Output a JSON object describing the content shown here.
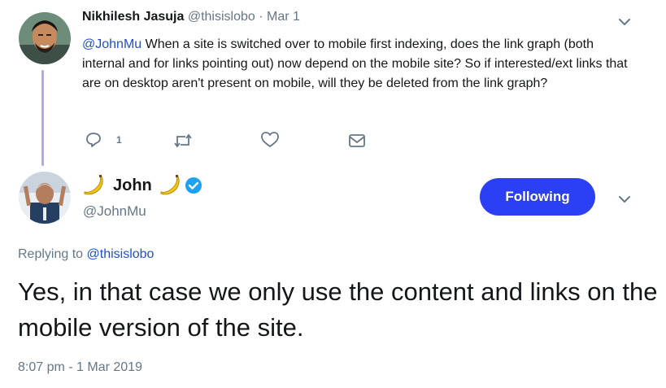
{
  "parent_tweet": {
    "author_name": "Nikhilesh Jasuja",
    "handle": "@thisislobo",
    "separator": "·",
    "date": "Mar 1",
    "mention": "@JohnMu",
    "body": " When a site is switched over to mobile first indexing, does the link graph (both internal and for links pointing out) now depend on the mobile site? So if interested/ext links that are on desktop aren't present on mobile, will they be deleted from the link graph?",
    "reply_count": "1",
    "icons": [
      "reply-icon",
      "retweet-icon",
      "like-icon",
      "direct-message-icon",
      "chevron-down-icon"
    ]
  },
  "main_tweet": {
    "author_name": "John",
    "emoji": "🍌",
    "handle": "@JohnMu",
    "follow_label": "Following",
    "replying_prefix": "Replying to ",
    "replying_handle": "@thisislobo",
    "body": "Yes, in that case we only use the content and links on the mobile version of the site.",
    "timestamp": "8:07 pm - 1 Mar 2019",
    "verified": true
  },
  "colors": {
    "accent": "#2b3ff5",
    "link": "#1f4fd0",
    "muted": "#657786",
    "thread_line": "#b9a4ee",
    "verified": "#1da1f2",
    "banana": "#f5c518"
  }
}
